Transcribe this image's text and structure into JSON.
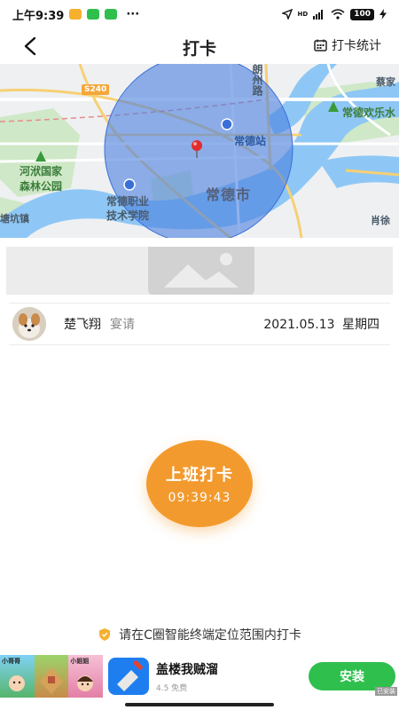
{
  "status_bar": {
    "time": "上午9:39",
    "more": "···",
    "signal": "HD",
    "battery": "100"
  },
  "nav": {
    "title": "打卡",
    "stats_label": "打卡统计",
    "icons": {
      "back": "chevron-left-icon",
      "stats": "calendar-icon"
    }
  },
  "map": {
    "labels": {
      "city": "常德市",
      "station": "常德站",
      "school_line1": "常德职业",
      "school_line2": "技术学院",
      "park_line1": "河洑国家",
      "park_line2": "森林公园",
      "theme_park": "常德欢乐水",
      "road_badge": "S240",
      "street": "朗州路",
      "town_left": "塘坑镇",
      "town_right": "肖徐",
      "top_right": "蔡家"
    },
    "colors": {
      "range_fill": "#4a7fe0",
      "water": "#8ec7f5",
      "green": "#c8e6c0"
    }
  },
  "user": {
    "name": "楚飞翔",
    "role": "宴请",
    "date": "2021.05.13 星期四"
  },
  "punch": {
    "label": "上班打卡",
    "time": "09:39:43",
    "color": "#f39a2e"
  },
  "hint": {
    "text": "请在C圈智能终端定位范围内打卡",
    "icon": "shield-icon"
  },
  "ad": {
    "thumb_labels": [
      "小哥哥",
      "小姐姐"
    ],
    "title": "盖楼我贼溜",
    "meta": "4.5 免费",
    "install_label": "安装",
    "badge": "已安装"
  }
}
